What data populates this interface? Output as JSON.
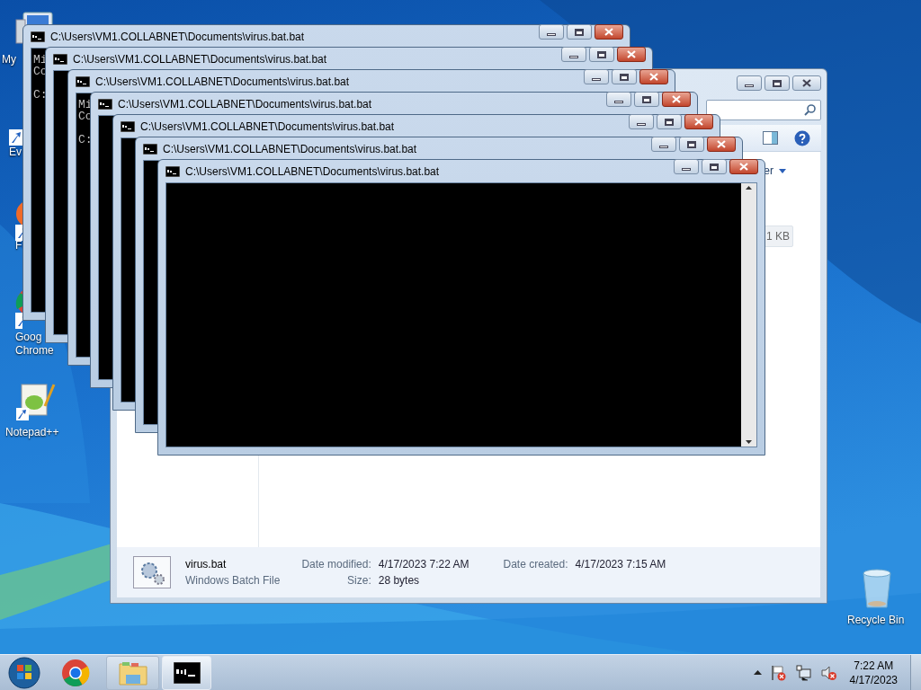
{
  "desktop_icons": [
    {
      "kind": "computer",
      "lines": [
        "My"
      ]
    },
    {
      "kind": "shortcut",
      "lines": [
        "Ev"
      ]
    },
    {
      "kind": "app",
      "lines": [
        "F"
      ]
    },
    {
      "kind": "chrome",
      "lines": [
        "Goog",
        "Chrome"
      ]
    },
    {
      "kind": "notepad",
      "lines": [
        "Notepad++"
      ]
    },
    {
      "kind": "recycle",
      "lines": [
        "Recycle Bin"
      ]
    }
  ],
  "explorer": {
    "header_fragment": "er",
    "size_fragment": "1 KB",
    "details": {
      "name": "virus.bat",
      "type": "Windows Batch File",
      "modified_label": "Date modified:",
      "modified": "4/17/2023 7:22 AM",
      "size_label": "Size:",
      "size": "28 bytes",
      "created_label": "Date created:",
      "created": "4/17/2023 7:15 AM"
    }
  },
  "console_windows": [
    {
      "title": "C:\\Users\\VM1.COLLABNET\\Documents\\virus.bat.bat",
      "paragraphs": [
        [
          "Mi",
          "Co"
        ],
        [
          "C:"
        ]
      ]
    },
    {
      "title": "C:\\Users\\VM1.COLLABNET\\Documents\\virus.bat.bat"
    },
    {
      "title": "C:\\Users\\VM1.COLLABNET\\Documents\\virus.bat.bat",
      "paragraphs": [
        [
          "Mi",
          "Co"
        ],
        [
          "C:"
        ]
      ]
    },
    {
      "title": "C:\\Users\\VM1.COLLABNET\\Documents\\virus.bat.bat"
    },
    {
      "title": "C:\\Users\\VM1.COLLABNET\\Documents\\virus.bat.bat"
    },
    {
      "title": "C:\\Users\\VM1.COLLABNET\\Documents\\virus.bat.bat"
    },
    {
      "title": "C:\\Users\\VM1.COLLABNET\\Documents\\virus.bat.bat"
    }
  ],
  "taskbar": {
    "items": [
      {
        "kind": "start",
        "selected": false
      },
      {
        "kind": "chrome",
        "selected": false
      },
      {
        "kind": "explorer",
        "selected": false
      },
      {
        "kind": "console",
        "selected": true
      }
    ],
    "clock": {
      "time": "7:22 AM",
      "date": "4/17/2023"
    }
  }
}
